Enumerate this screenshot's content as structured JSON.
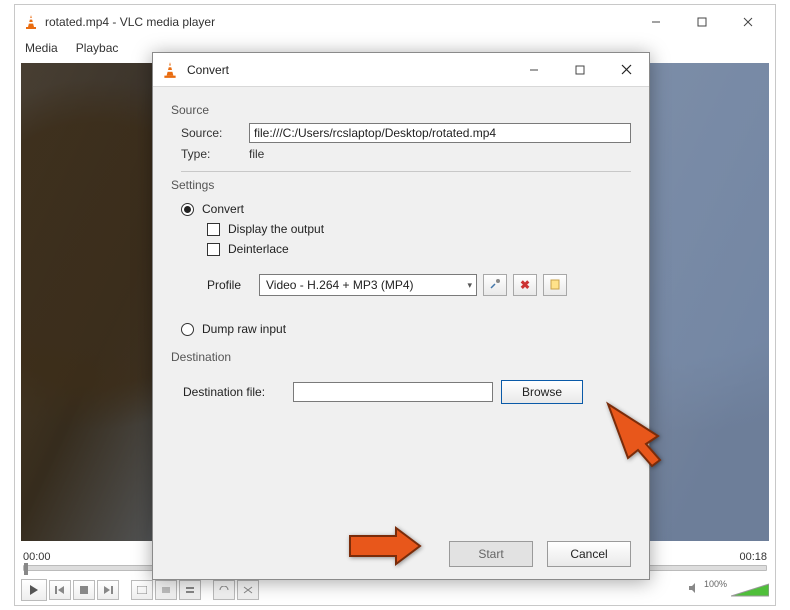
{
  "main_window": {
    "title": "rotated.mp4 - VLC media player",
    "menubar": [
      "Media",
      "Playbac"
    ],
    "time_left": "00:00",
    "time_right": "00:18",
    "volume_pct": "100%"
  },
  "dialog": {
    "title": "Convert",
    "source": {
      "section_label": "Source",
      "source_label": "Source:",
      "source_value": "file:///C:/Users/rcslaptop/Desktop/rotated.mp4",
      "type_label": "Type:",
      "type_value": "file"
    },
    "settings": {
      "section_label": "Settings",
      "convert_label": "Convert",
      "display_output_label": "Display the output",
      "deinterlace_label": "Deinterlace",
      "profile_label": "Profile",
      "profile_value": "Video - H.264 + MP3 (MP4)",
      "dump_label": "Dump raw input"
    },
    "destination": {
      "section_label": "Destination",
      "dest_file_label": "Destination file:",
      "dest_file_value": "",
      "browse_label": "Browse"
    },
    "footer": {
      "start_label": "Start",
      "cancel_label": "Cancel"
    }
  },
  "icons": {
    "tools": "tools-icon",
    "delete": "delete-icon",
    "new": "new-profile-icon"
  }
}
